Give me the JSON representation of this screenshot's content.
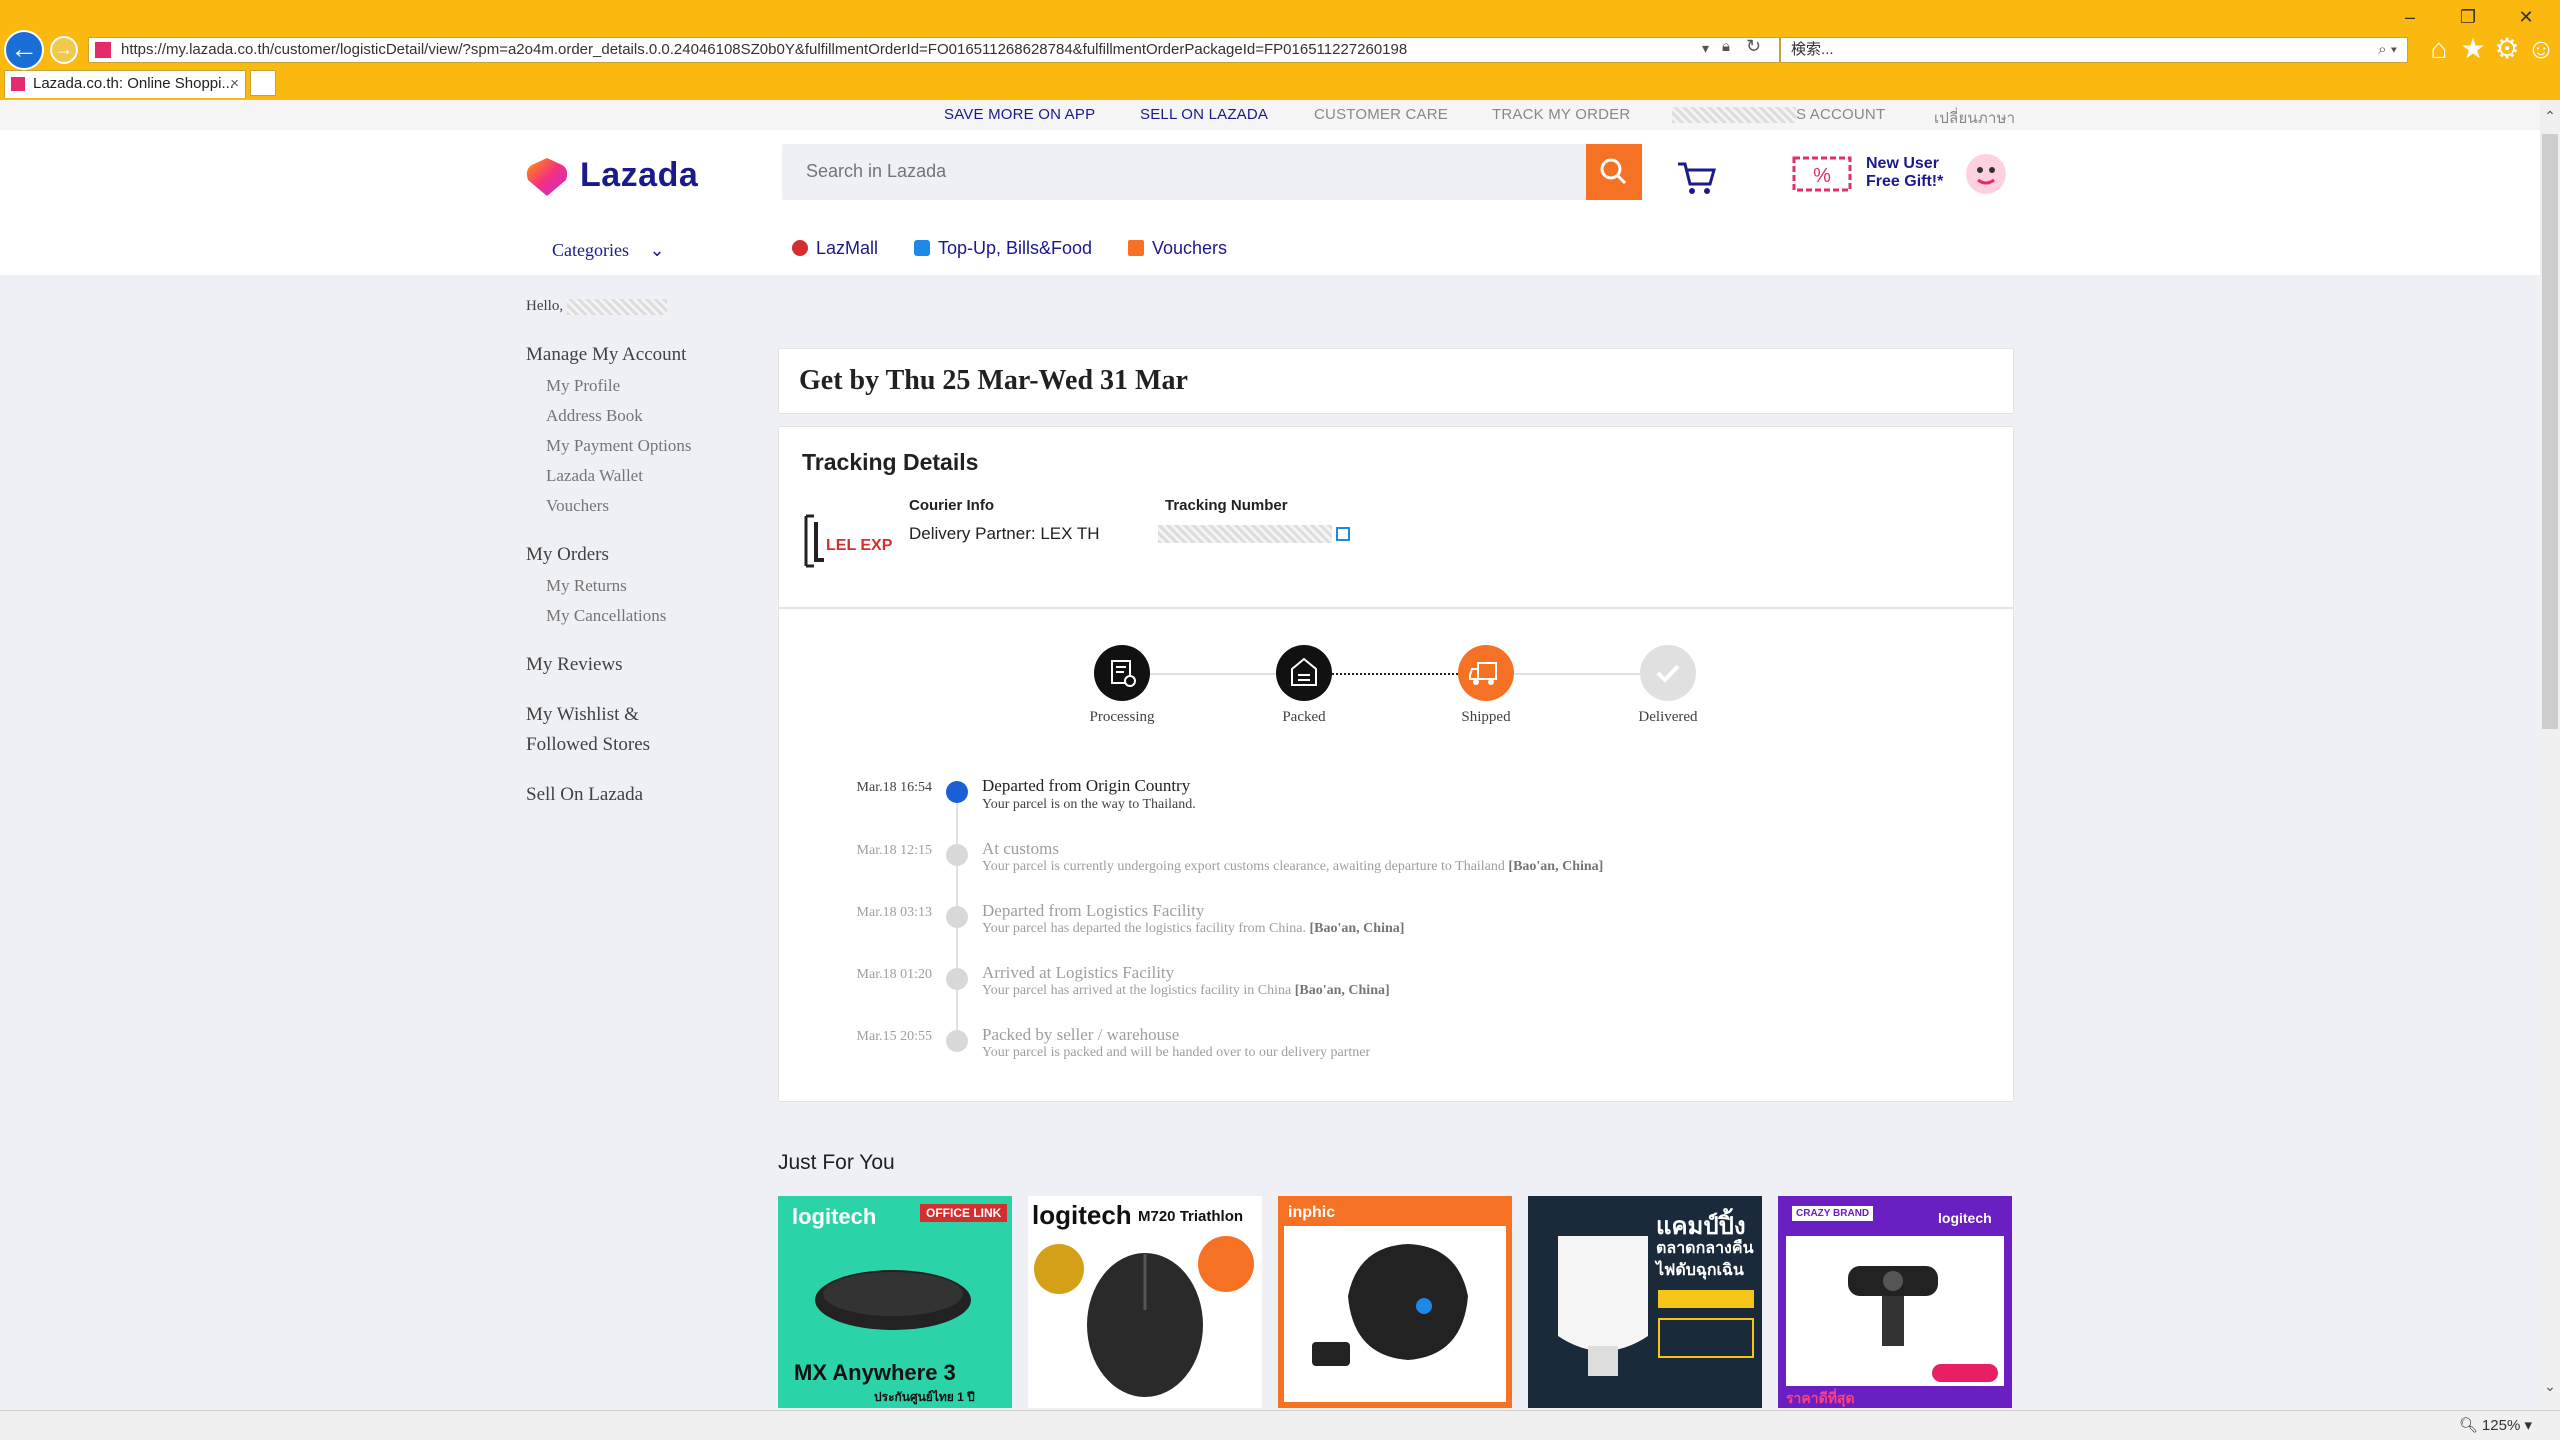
{
  "browser": {
    "url": "https://my.lazada.co.th/customer/logisticDetail/view/?spm=a2o4m.order_details.0.0.24046108SZ0b0Y&fulfillmentOrderId=FO016511268628784&fulfillmentOrderPackageId=FP016511227260198",
    "search_placeholder": "検索...",
    "tab_title": "Lazada.co.th: Online Shoppi...",
    "zoom": "125%",
    "icons": [
      "back-icon",
      "forward-icon",
      "lock-icon",
      "refresh-icon",
      "home-icon",
      "star-icon",
      "gear-icon",
      "smiley-icon"
    ]
  },
  "topbar": {
    "save_more": "SAVE MORE ON APP",
    "sell": "SELL ON LAZADA",
    "care": "CUSTOMER CARE",
    "track": "TRACK MY ORDER",
    "account": "S ACCOUNT",
    "language": "เปลี่ยนภาษา"
  },
  "header": {
    "logo": "Lazada",
    "search_placeholder": "Search in Lazada",
    "promo": "New User Free Gift!*",
    "categories": "Categories",
    "nav": [
      "LazMall",
      "Top-Up, Bills&Food",
      "Vouchers"
    ]
  },
  "sidebar": {
    "hello": "Hello,",
    "manage": "Manage My Account",
    "manage_items": [
      "My Profile",
      "Address Book",
      "My Payment Options",
      "Lazada Wallet",
      "Vouchers"
    ],
    "orders": "My Orders",
    "order_items": [
      "My Returns",
      "My Cancellations"
    ],
    "reviews": "My Reviews",
    "wishlist_1": "My Wishlist &",
    "wishlist_2": "Followed Stores",
    "sell": "Sell On Lazada"
  },
  "eta": "Get by Thu 25 Mar-Wed 31 Mar",
  "tracking": {
    "title": "Tracking Details",
    "courier_label": "Courier Info",
    "courier_value": "Delivery Partner: LEX TH",
    "number_label": "Tracking Number",
    "courier_logo": "LEL EXPRESS"
  },
  "steps": [
    {
      "label": "Processing",
      "icon": "processing-icon",
      "state": "done"
    },
    {
      "label": "Packed",
      "icon": "box-icon",
      "state": "done"
    },
    {
      "label": "Shipped",
      "icon": "truck-icon",
      "state": "current"
    },
    {
      "label": "Delivered",
      "icon": "check-icon",
      "state": "pending"
    }
  ],
  "events": [
    {
      "time": "Mar.18 16:54",
      "title": "Departed from Origin Country",
      "desc": "Your parcel is on the way to Thailand.",
      "loc": "",
      "active": true
    },
    {
      "time": "Mar.18 12:15",
      "title": "At customs",
      "desc": "Your parcel is currently undergoing export customs clearance, awaiting departure to Thailand ",
      "loc": "[Bao'an, China]",
      "active": false
    },
    {
      "time": "Mar.18 03:13",
      "title": "Departed from Logistics Facility",
      "desc": "Your parcel has departed the logistics facility from China. ",
      "loc": "[Bao'an, China]",
      "active": false
    },
    {
      "time": "Mar.18 01:20",
      "title": "Arrived at Logistics Facility",
      "desc": "Your parcel has arrived at the logistics facility in China ",
      "loc": "[Bao'an, China]",
      "active": false
    },
    {
      "time": "Mar.15 20:55",
      "title": "Packed by seller / warehouse",
      "desc": "Your parcel is packed and will be handed over to our delivery partner",
      "loc": "",
      "active": false
    }
  ],
  "just_for_you": {
    "title": "Just For You",
    "products": [
      {
        "brand": "logitech",
        "tag": "OFFICE LINK",
        "caption": "MX Anywhere 3",
        "sub": "ประกันศูนย์ไทย 1 ปี",
        "bg": "#2bd3a8"
      },
      {
        "brand": "logitech",
        "tag": "M720 Triathlon",
        "caption": "",
        "sub": "",
        "bg": "#ffffff"
      },
      {
        "brand": "inphic",
        "tag": "",
        "caption": "",
        "sub": "",
        "bg": "#f57224"
      },
      {
        "brand": "",
        "tag": "แคมป์ปิ้ง",
        "caption": "ตลาดกลางคืน",
        "sub": "ไฟดับฉุกเฉิน",
        "bg": "#1a2a3a"
      },
      {
        "brand": "logitech",
        "tag": "CRAZY BRAND",
        "caption": "ราคาดีที่สุด",
        "sub": "",
        "bg": "#6a1fc2"
      }
    ]
  },
  "colors": {
    "brand_orange": "#f57224",
    "brand_blue": "#1a1a8c",
    "active_dot": "#1a5fd6",
    "chrome_yellow": "#fbb80e"
  }
}
